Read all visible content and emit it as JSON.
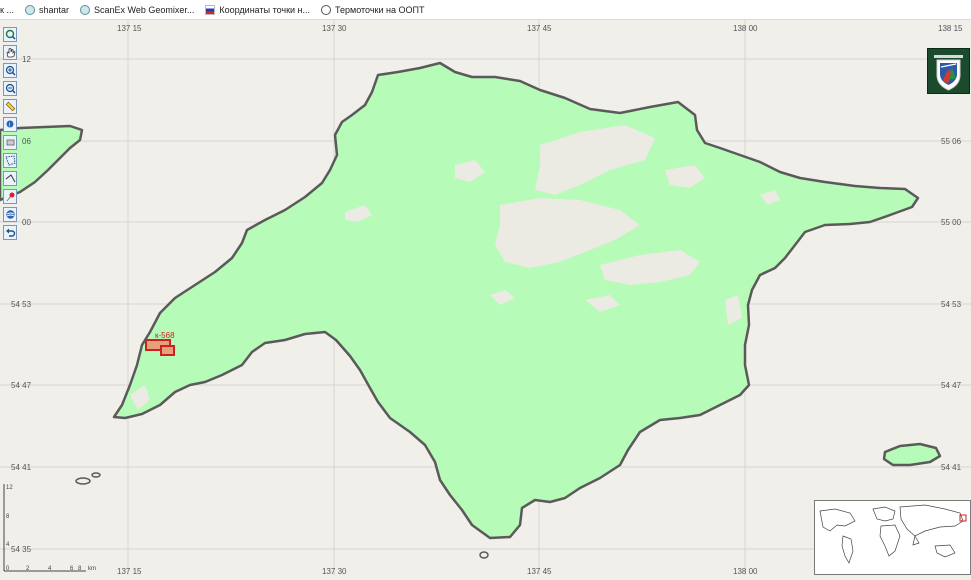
{
  "bookmarks_bar": {
    "items": [
      {
        "label": "к ...",
        "icon": "cut-off-favicon"
      },
      {
        "label": "shantar",
        "icon": "globe-favicon"
      },
      {
        "label": "ScanEx Web Geomixer...",
        "icon": "globe-favicon"
      },
      {
        "label": "Координаты точки н...",
        "icon": "russian-flag-favicon"
      },
      {
        "label": "Термоточки на ООПТ",
        "icon": "web-globe-favicon"
      }
    ]
  },
  "map": {
    "top_lon_labels": [
      "137 15",
      "137 30",
      "137 45",
      "138 00",
      "138 15"
    ],
    "bottom_lon_labels": [
      "137 15",
      "137 30",
      "137 45",
      "138 00"
    ],
    "left_lat_labels": [
      "12",
      "06",
      "00",
      "54 53",
      "54 47",
      "54 41",
      "54 35"
    ],
    "right_lat_labels": [
      "55 06",
      "55 00",
      "54 53",
      "54 47",
      "54 41"
    ],
    "feature_label": "к-568",
    "scale_labels": [
      "12",
      "8",
      "4",
      "0",
      "2",
      "4",
      "6",
      "8",
      "km"
    ],
    "colors": {
      "land_background": "#f1efea",
      "polygon_fill": "#b6fbb8",
      "polygon_outline": "#5a5a5a",
      "feature_fill": "#e8a07a",
      "feature_outline": "#cc2222",
      "grid": "#d9d6d0"
    }
  },
  "toolbar": {
    "tools": [
      "zoom-extent-icon",
      "pan-hand-icon",
      "zoom-in-icon",
      "zoom-out-icon",
      "measure-ruler-icon",
      "identify-icon",
      "eraser-icon",
      "select-polygon-icon",
      "draw-line-icon",
      "pin-icon",
      "layers-icon",
      "undo-icon"
    ]
  },
  "logo": {
    "icon": "agency-emblem-logo"
  }
}
